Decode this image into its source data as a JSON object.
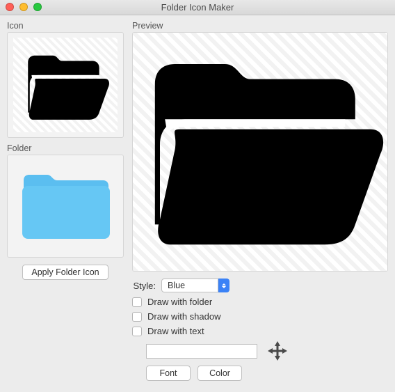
{
  "window": {
    "title": "Folder Icon Maker"
  },
  "sections": {
    "icon_label": "Icon",
    "folder_label": "Folder",
    "preview_label": "Preview"
  },
  "buttons": {
    "apply_folder_icon": "Apply Folder Icon",
    "font": "Font",
    "color": "Color"
  },
  "controls": {
    "style_label": "Style:",
    "style_value": "Blue",
    "draw_with_folder": "Draw with folder",
    "draw_with_shadow": "Draw with shadow",
    "draw_with_text": "Draw with text",
    "text_value": ""
  },
  "icons": {
    "source_name": "open-folder-icon",
    "folder_name": "blue-folder-icon",
    "move_name": "move-icon"
  },
  "colors": {
    "folder_blue": "#66c7f4",
    "folder_tab": "#5bbef0",
    "accent": "#3b82f6"
  }
}
